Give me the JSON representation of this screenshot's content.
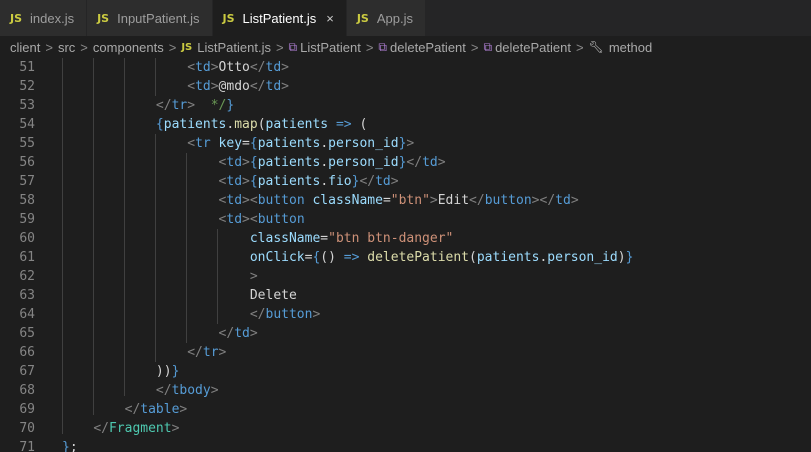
{
  "tabs": [
    {
      "icon": "JS",
      "label": "index.js",
      "active": false
    },
    {
      "icon": "JS",
      "label": "InputPatient.js",
      "active": false
    },
    {
      "icon": "JS",
      "label": "ListPatient.js",
      "active": true,
      "close": "×"
    },
    {
      "icon": "JS",
      "label": "App.js",
      "active": false
    }
  ],
  "breadcrumb": {
    "items": [
      "client",
      "src",
      "components",
      "ListPatient.js",
      "ListPatient",
      "deletePatient",
      "deletePatient",
      "method"
    ],
    "separator": ">"
  },
  "colors": {
    "tag": "#569cd6",
    "string": "#ce9178",
    "attribute": "#9cdcfe",
    "function": "#dcdcaa",
    "component": "#4ec9b0"
  },
  "editor": {
    "lines": [
      {
        "num": "51",
        "text": "                <td>Otto</td>"
      },
      {
        "num": "52",
        "text": "                <td>@mdo</td>"
      },
      {
        "num": "53",
        "text": "            </tr>  */}"
      },
      {
        "num": "54",
        "text": "            {patients.map(patients => ("
      },
      {
        "num": "55",
        "text": "                <tr key={patients.person_id}>"
      },
      {
        "num": "56",
        "text": "                    <td>{patients.person_id}</td>"
      },
      {
        "num": "57",
        "text": "                    <td>{patients.fio}</td>"
      },
      {
        "num": "58",
        "text": "                    <td><button className=\"btn\">Edit</button></td>"
      },
      {
        "num": "59",
        "text": "                    <td><button"
      },
      {
        "num": "60",
        "text": "                        className=\"btn btn-danger\""
      },
      {
        "num": "61",
        "text": "                        onClick={() => deletePatient(patients.person_id)}"
      },
      {
        "num": "62",
        "text": "                        >"
      },
      {
        "num": "63",
        "text": "                        Delete"
      },
      {
        "num": "64",
        "text": "                        </button>"
      },
      {
        "num": "65",
        "text": "                    </td>"
      },
      {
        "num": "66",
        "text": "                </tr>"
      },
      {
        "num": "67",
        "text": "            ))}"
      },
      {
        "num": "68",
        "text": "            </tbody>"
      },
      {
        "num": "69",
        "text": "        </table>"
      },
      {
        "num": "70",
        "text": "    </Fragment>"
      },
      {
        "num": "71",
        "text": "};"
      }
    ]
  }
}
